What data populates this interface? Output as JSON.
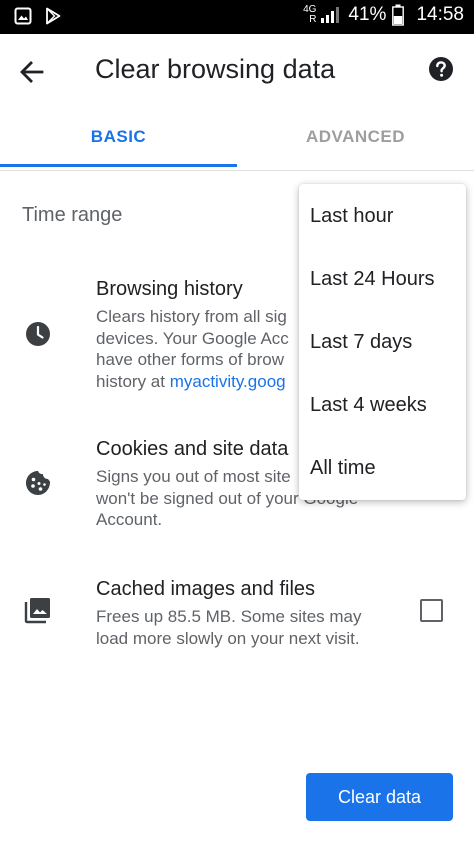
{
  "status_bar": {
    "network": "4G",
    "roaming": "R",
    "battery": "41%",
    "time": "14:58",
    "icons": [
      "gallery-icon",
      "play-store-icon",
      "signal-icon",
      "battery-icon"
    ]
  },
  "app_bar": {
    "title": "Clear browsing data"
  },
  "tabs": [
    {
      "label": "BASIC",
      "selected": true
    },
    {
      "label": "ADVANCED",
      "selected": false
    }
  ],
  "time_range_label": "Time range",
  "items": [
    {
      "icon": "clock-icon",
      "heading": "Browsing history",
      "desc_lines": [
        "Clears history from all sig",
        "devices. Your Google Acc",
        "have other forms of brow"
      ],
      "desc_last_prefix": "history at ",
      "desc_link": "myactivity.goog"
    },
    {
      "icon": "cookie-icon",
      "heading": "Cookies and site data",
      "desc_lines": [
        "Signs you out of most site",
        "won't be signed out of your Google",
        "Account."
      ]
    },
    {
      "icon": "image-icon",
      "heading": "Cached images and files",
      "desc_lines": [
        "Frees up 85.5 MB. Some sites may",
        "load more slowly on your next visit."
      ],
      "checked": false
    }
  ],
  "dropdown": {
    "options": [
      "Last hour",
      "Last 24 Hours",
      "Last 7 days",
      "Last 4 weeks",
      "All time"
    ]
  },
  "clear_button_label": "Clear data",
  "colors": {
    "accent": "#1a73e8",
    "status_bar": "#000000"
  }
}
